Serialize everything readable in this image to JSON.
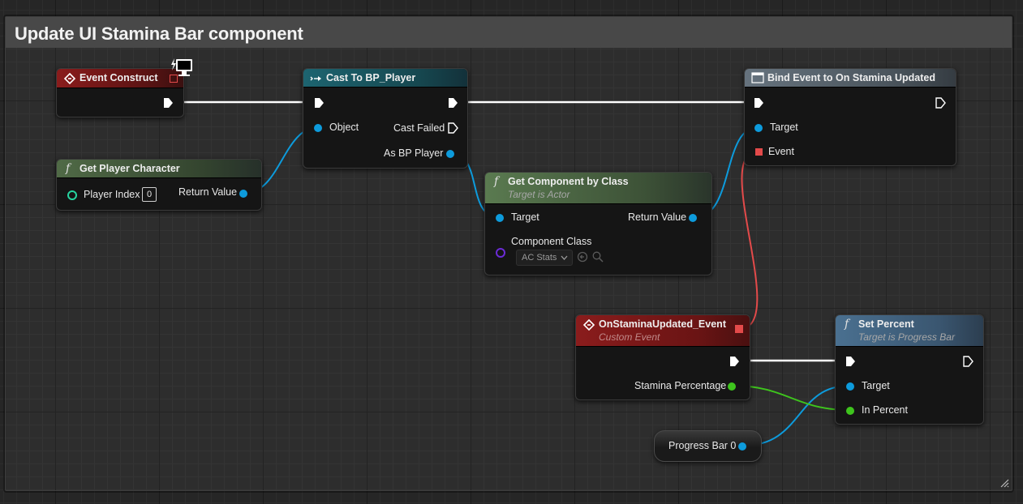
{
  "comment": {
    "title": "Update UI Stamina Bar component"
  },
  "nodes": {
    "event_construct": {
      "title": "Event Construct"
    },
    "get_player_character": {
      "title": "Get Player Character",
      "player_index_label": "Player Index",
      "player_index_value": "0",
      "return_value_label": "Return Value"
    },
    "cast_to_bp_player": {
      "title": "Cast To BP_Player",
      "object_label": "Object",
      "cast_failed_label": "Cast Failed",
      "as_bp_player_label": "As BP Player"
    },
    "get_component_by_class": {
      "title": "Get Component by Class",
      "subtitle": "Target is Actor",
      "target_label": "Target",
      "return_value_label": "Return Value",
      "component_class_label": "Component Class",
      "component_class_value": "AC Stats"
    },
    "bind_event": {
      "title": "Bind Event to On Stamina Updated",
      "target_label": "Target",
      "event_label": "Event"
    },
    "on_stamina_updated_event": {
      "title": "OnStaminaUpdated_Event",
      "subtitle": "Custom Event",
      "stamina_percentage_label": "Stamina Percentage"
    },
    "set_percent": {
      "title": "Set Percent",
      "subtitle": "Target is Progress Bar",
      "target_label": "Target",
      "in_percent_label": "In Percent"
    },
    "progress_bar_var": {
      "label": "Progress Bar 0"
    }
  },
  "icons": {
    "event": "event-diamond-icon",
    "function": "function-f-icon",
    "cast": "cast-arrow-icon",
    "bind": "bind-event-icon",
    "monitor": "client-monitor-icon",
    "browse": "browse-arrow-icon",
    "search": "search-icon"
  },
  "colors": {
    "event_header": "#8a1c1c",
    "function_header": "#506a46",
    "cast_header": "#1a5a66",
    "bind_header": "#5a6670",
    "set_percent_header": "#3a5c78",
    "exec_wire": "#ffffff",
    "object_wire": "#0d9bdc",
    "float_wire": "#3ec41d",
    "delegate_wire": "#e34a4a",
    "int_pin": "#26d4a0",
    "class_pin": "#6b2bd6"
  }
}
